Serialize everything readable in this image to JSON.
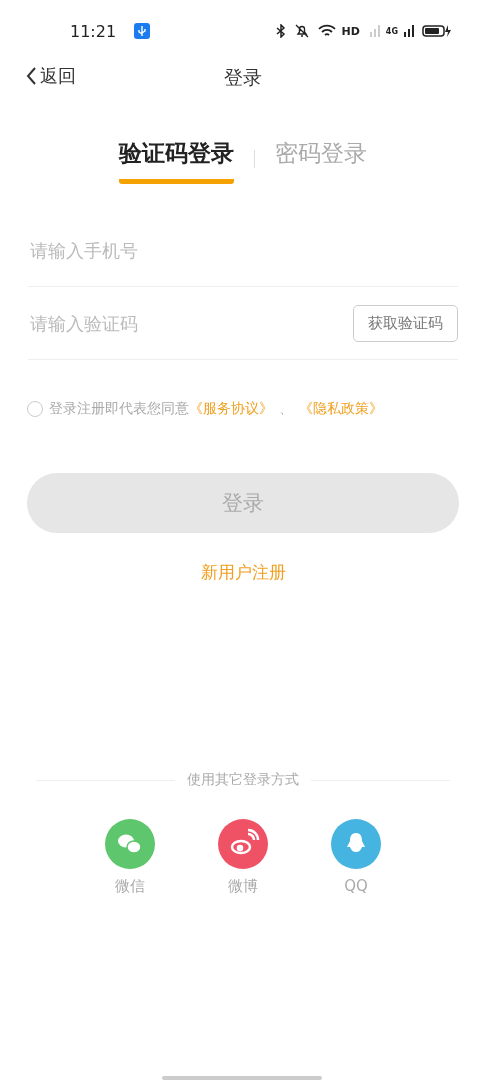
{
  "status_bar": {
    "time": "11:21",
    "hd": "HD",
    "network": "4G"
  },
  "nav": {
    "back": "返回",
    "title": "登录"
  },
  "tabs": [
    {
      "label": "验证码登录",
      "selected": true
    },
    {
      "label": "密码登录",
      "selected": false
    }
  ],
  "phone_field": {
    "placeholder": "请输入手机号"
  },
  "code_field": {
    "placeholder": "请输入验证码",
    "button": "获取验证码"
  },
  "agreement": {
    "checked": false,
    "text": "登录注册即代表您同意",
    "links": [
      "《服务协议》",
      "《隐私政策》"
    ],
    "separator": "、"
  },
  "login_button": {
    "label": "登录",
    "disabled": true
  },
  "register_link": "新用户注册",
  "other_login": {
    "title": "使用其它登录方式",
    "items": [
      {
        "kind": "wechat",
        "label": "微信",
        "color": "#5ec66c"
      },
      {
        "kind": "weibo",
        "label": "微博",
        "color": "#f05265"
      },
      {
        "kind": "qq",
        "label": "QQ",
        "color": "#46b4e0"
      }
    ]
  }
}
